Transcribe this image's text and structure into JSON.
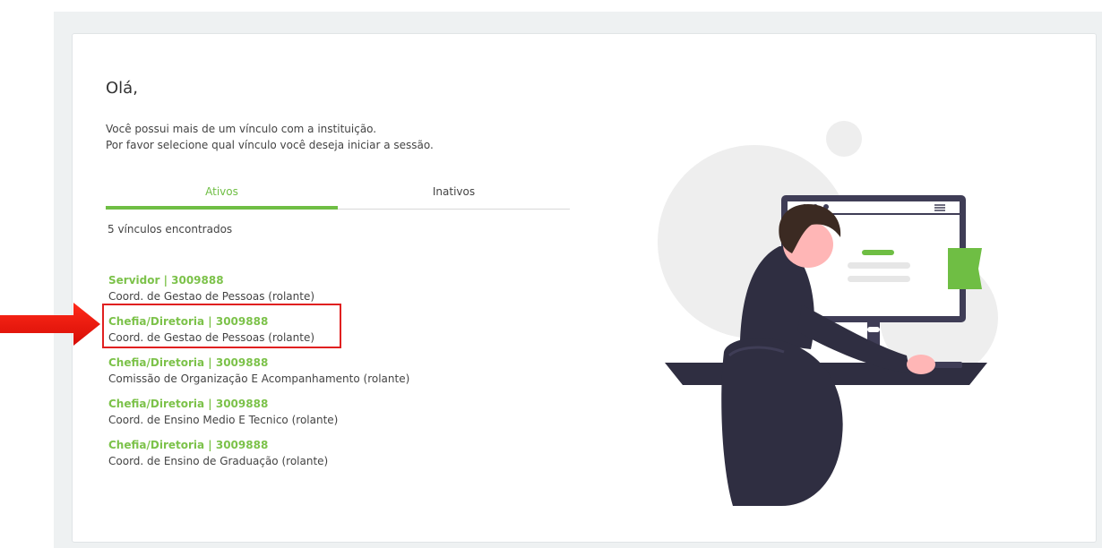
{
  "greeting": "Olá,",
  "intro": {
    "line1": "Você possui mais de um vínculo com a instituição.",
    "line2": "Por favor selecione qual vínculo você deseja iniciar a sessão."
  },
  "tabs": {
    "active_label": "Ativos",
    "inactive_label": "Inativos"
  },
  "count_text": "5 vínculos encontrados",
  "bonds": [
    {
      "title": "Servidor | 3009888",
      "subtitle": "Coord. de Gestao de Pessoas (rolante)"
    },
    {
      "title": "Chefia/Diretoria | 3009888",
      "subtitle": "Coord. de Gestao de Pessoas (rolante)"
    },
    {
      "title": "Chefia/Diretoria | 3009888",
      "subtitle": "Comissão de Organização E Acompanhamento (rolante)"
    },
    {
      "title": "Chefia/Diretoria | 3009888",
      "subtitle": "Coord. de Ensino Medio E Tecnico (rolante)"
    },
    {
      "title": "Chefia/Diretoria | 3009888",
      "subtitle": "Coord. de Ensino de Graduação (rolante)"
    }
  ],
  "colors": {
    "accent_green": "#6fbe44",
    "highlight_red": "#e02020"
  },
  "icons": {
    "annotation": "red-arrow-icon",
    "illustration": "person-at-computer-illustration"
  }
}
